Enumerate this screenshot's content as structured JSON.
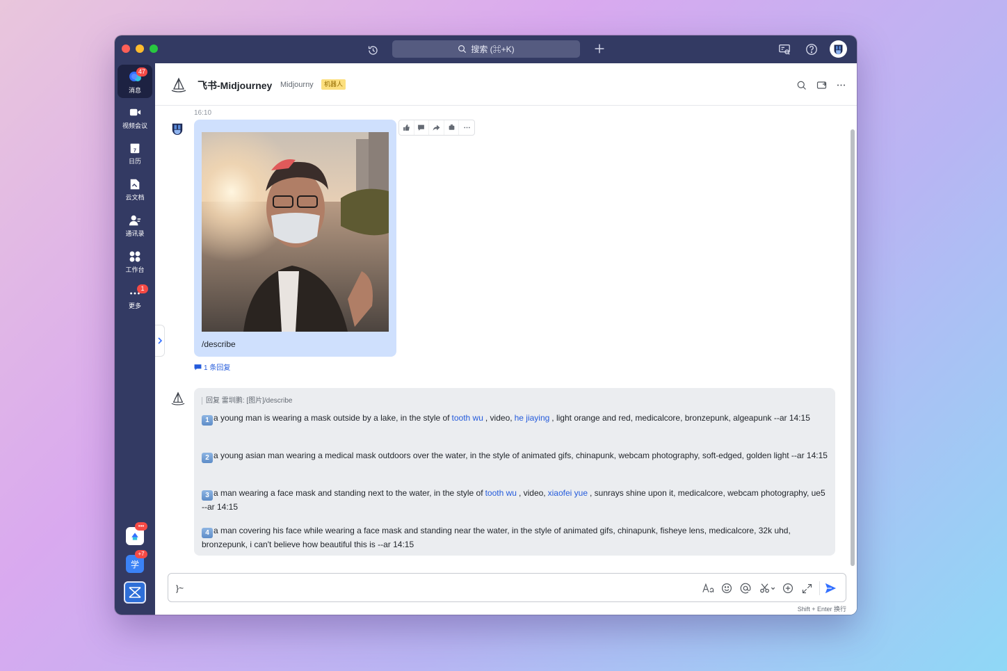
{
  "titlebar": {
    "search_placeholder": "搜索 (⌘+K)",
    "history_icon": "history-icon",
    "plus_icon": "plus-icon"
  },
  "sidebar": {
    "items": [
      {
        "label": "消息",
        "badge": "47",
        "icon": "chat-icon",
        "active": true
      },
      {
        "label": "视频会议",
        "badge": "",
        "icon": "video-icon"
      },
      {
        "label": "日历",
        "badge": "",
        "icon": "calendar-icon"
      },
      {
        "label": "云文档",
        "badge": "",
        "icon": "docs-icon"
      },
      {
        "label": "通讯录",
        "badge": "",
        "icon": "contacts-icon"
      },
      {
        "label": "工作台",
        "badge": "",
        "icon": "workplace-icon"
      },
      {
        "label": "更多",
        "badge": "1",
        "icon": "more-icon"
      }
    ],
    "apps": [
      {
        "badge": "•••",
        "icon": "app-icon"
      },
      {
        "badge": "+7",
        "label": "学",
        "icon": "learn-icon"
      },
      {
        "icon": "feishu-icon"
      }
    ],
    "calendar_day": "7"
  },
  "chat": {
    "title": "飞书-Midjourney",
    "subtitle": "Midjourny",
    "tag": "机器人"
  },
  "messages": {
    "timestamp": "16:10",
    "user_text": "/describe",
    "reply_count": "1 条回复",
    "bot_quote": "回复 雷圳鹏: [图片]/describe",
    "bot_lines": [
      {
        "num": "1",
        "parts": [
          "a young man is wearing a mask outside by a lake, in the style of",
          "tooth wu",
          ", video,",
          "he jiaying",
          ", light orange and red, medicalcore, bronzepunk, algeapunk --ar 14:15"
        ]
      },
      {
        "num": "2",
        "text": "a young asian man wearing a medical mask outdoors over the water, in the style of animated gifs, chinapunk, webcam photography, soft-edged, golden light --ar 14:15"
      },
      {
        "num": "3",
        "parts": [
          "a man wearing a face mask and standing next to the water, in the style of",
          "tooth wu",
          ", video,",
          "xiaofei yue",
          ", sunrays shine upon it, medicalcore, webcam photography, ue5 --ar 14:15"
        ]
      },
      {
        "num": "4",
        "text": "a man covering his face while wearing a face mask and standing near the water, in the style of animated gifs, chinapunk, fisheye lens, medicalcore, 32k uhd, bronzepunk, i can't believe how beautiful this is --ar 14:15"
      }
    ]
  },
  "composer": {
    "value": "}~",
    "hint": "Shift + Enter 换行"
  },
  "colors": {
    "titlebar": "#333a63",
    "user_bubble": "#cfe0fd",
    "bot_bubble": "#ebedf0",
    "link": "#245bdb",
    "badge": "#f54a45"
  }
}
